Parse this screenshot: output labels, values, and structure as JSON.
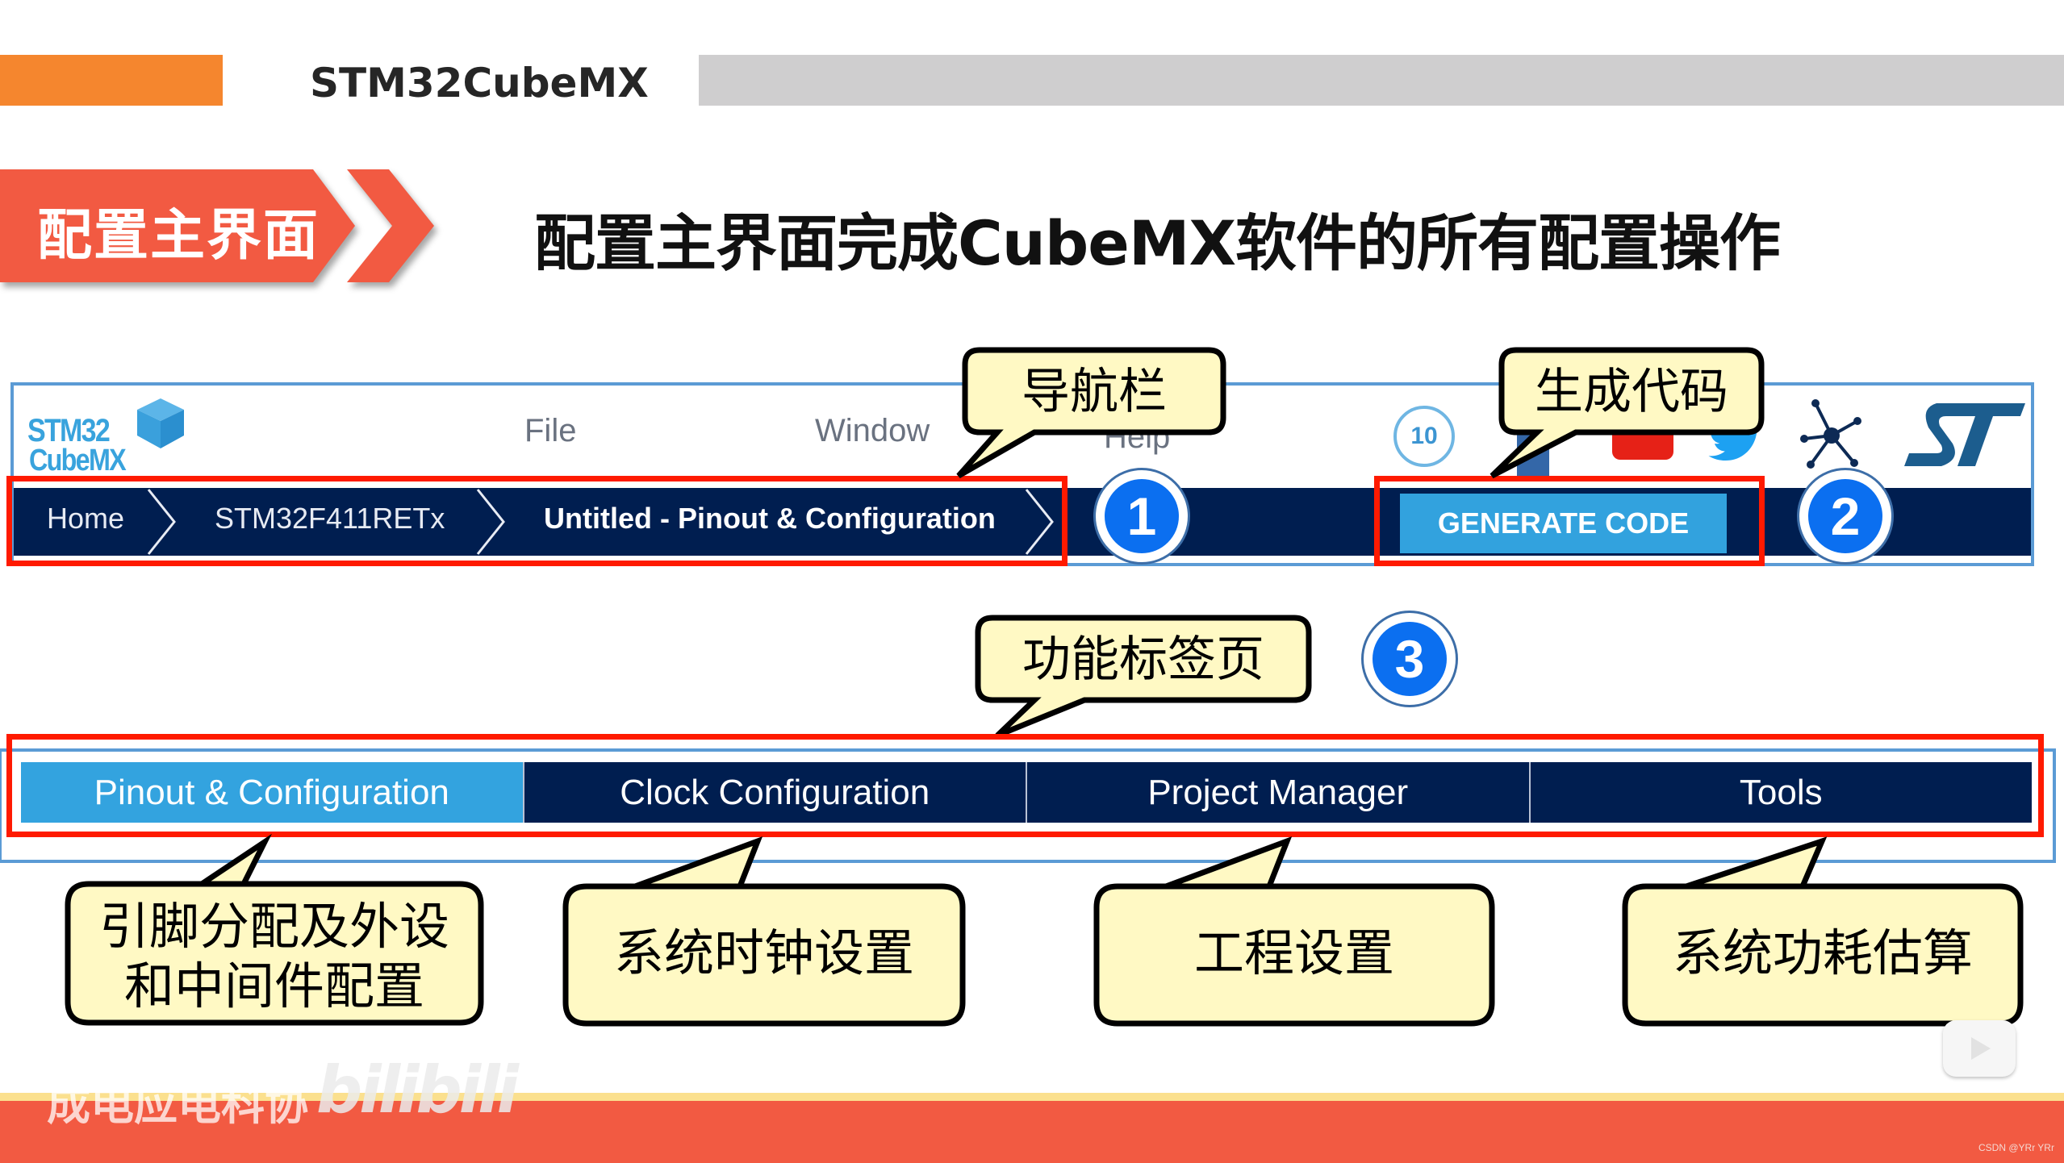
{
  "slide": {
    "deck_title": "STM32CubeMX",
    "section_badge": "配置主界面",
    "heading": "配置主界面完成CubeMX软件的所有配置操作",
    "colors": {
      "accent_orange": "#f5862e",
      "badge_red": "#f25a42",
      "navbar_navy": "#001e50",
      "active_tab_blue": "#33a3df",
      "highlight_red": "#ff1a00",
      "callout_fill": "#fff9c4",
      "circle_blue": "#0b6ff0"
    }
  },
  "cubemx": {
    "logo": {
      "line1": "STM32",
      "line2": "CubeMX",
      "icon": "cube-icon"
    },
    "menu": [
      "File",
      "Window",
      "Help"
    ],
    "breadcrumb": [
      "Home",
      "STM32F411RETx",
      "Untitled - Pinout & Configuration"
    ],
    "generate_button": "GENERATE CODE",
    "social_icons": [
      "10-years-badge-icon",
      "linkedin-icon",
      "youtube-icon",
      "twitter-icon",
      "network-icon",
      "st-logo-icon"
    ],
    "ten_years_label": "10",
    "tabs": [
      {
        "label": "Pinout & Configuration",
        "active": true
      },
      {
        "label": "Clock Configuration",
        "active": false
      },
      {
        "label": "Project Manager",
        "active": false
      },
      {
        "label": "Tools",
        "active": false
      }
    ]
  },
  "annotations": {
    "markers": [
      "1",
      "2",
      "3"
    ],
    "callouts": {
      "navbar": "导航栏",
      "generate": "生成代码",
      "tabs": "功能标签页",
      "pinout_line1": "引脚分配及外设",
      "pinout_line2": "和中间件配置",
      "clock": "系统时钟设置",
      "project": "工程设置",
      "tools": "系统功耗估算"
    }
  },
  "footer": {
    "watermark_text": "成电应电科协",
    "watermark_logo": "bilibili",
    "credit": "CSDN @YRr YRr"
  }
}
